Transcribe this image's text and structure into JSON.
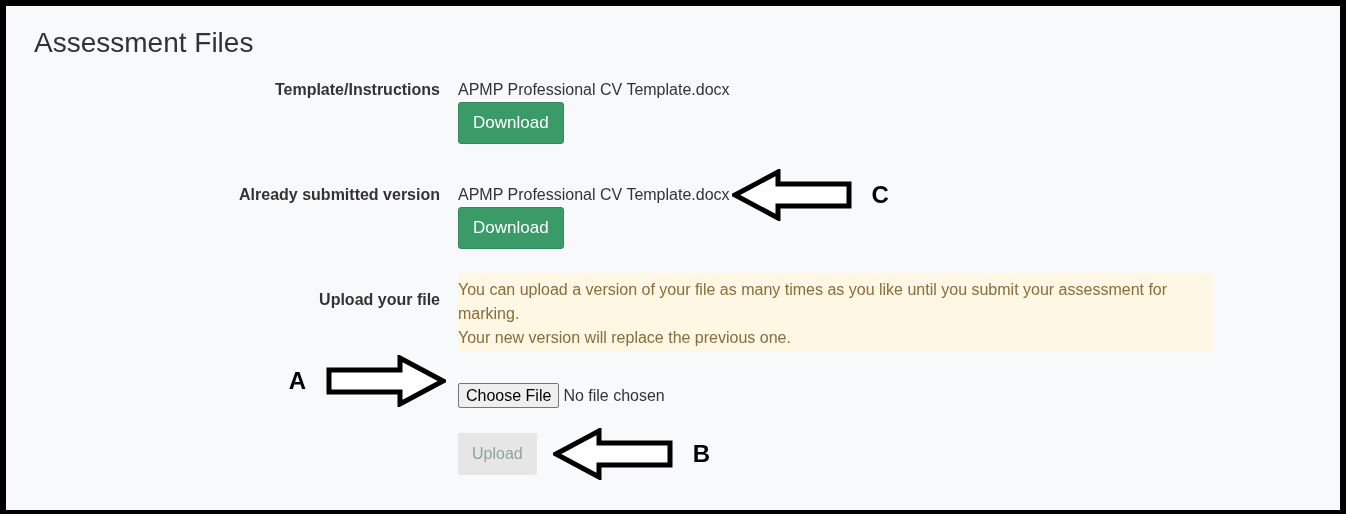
{
  "title": "Assessment Files",
  "rows": [
    {
      "label": "Template/Instructions",
      "file_name": "APMP Professional CV Template.docx",
      "button": "Download"
    },
    {
      "label": "Already submitted version",
      "file_name": "APMP Professional CV Template.docx",
      "button": "Download",
      "annotation": {
        "letter": "C",
        "points_left": true
      }
    }
  ],
  "upload": {
    "label": "Upload your file",
    "notice": [
      "You can upload a version of your file as many times as you like until you submit your assessment for marking.",
      "Your new version will replace the previous one."
    ],
    "file_input": {
      "button": "Choose File",
      "status": "No file chosen",
      "annotation": {
        "letter": "A",
        "points_left": false
      }
    },
    "upload_button": {
      "label": "Upload",
      "disabled": true,
      "annotation": {
        "letter": "B",
        "points_left": true
      }
    }
  }
}
